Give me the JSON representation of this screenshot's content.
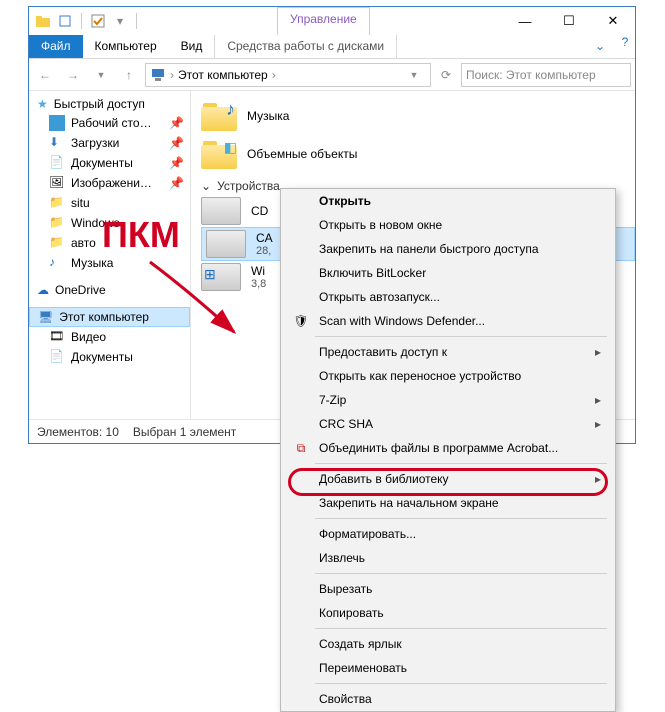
{
  "titlebar": {
    "title": "Этот компьютер",
    "manage": "Управление"
  },
  "ribbon": {
    "file": "Файл",
    "computer": "Компьютер",
    "view": "Вид",
    "disktools": "Средства работы с дисками"
  },
  "address": {
    "root": "Этот компьютер"
  },
  "search": {
    "placeholder": "Поиск: Этот компьютер"
  },
  "sidebar": {
    "quick": "Быстрый доступ",
    "items": [
      "Рабочий сто…",
      "Загрузки",
      "Документы",
      "Изображени…",
      "situ",
      "Windows",
      "авто",
      "Музыка"
    ],
    "onedrive": "OneDrive",
    "thispc": "Этот компьютер",
    "video": "Видео",
    "docs": "Документы"
  },
  "content": {
    "music": "Музыка",
    "objects3d": "Объемные объекты",
    "devices_header": "Устройства",
    "cd": "CD",
    "ca_prefix": "CA",
    "ca_size": "28,",
    "win": "Wi",
    "win_size": "3,8"
  },
  "status": {
    "count": "Элементов: 10",
    "selected": "Выбран 1 элемент"
  },
  "annotation": {
    "rmb": "ПКМ"
  },
  "ctx": {
    "open": "Открыть",
    "open_new": "Открыть в новом окне",
    "pin_qa": "Закрепить на панели быстрого доступа",
    "bitlocker": "Включить BitLocker",
    "autoplay": "Открыть автозапуск...",
    "defender": "Scan with Windows Defender...",
    "share": "Предоставить доступ к",
    "portable": "Открыть как переносное устройство",
    "sevenzip": "7-Zip",
    "crc": "CRC SHA",
    "acrobat": "Объединить файлы в программе Acrobat...",
    "library": "Добавить в библиотеку",
    "pin_start": "Закрепить на начальном экране",
    "format": "Форматировать...",
    "eject": "Извлечь",
    "cut": "Вырезать",
    "copy": "Копировать",
    "shortcut": "Создать ярлык",
    "rename": "Переименовать",
    "properties": "Свойства"
  }
}
